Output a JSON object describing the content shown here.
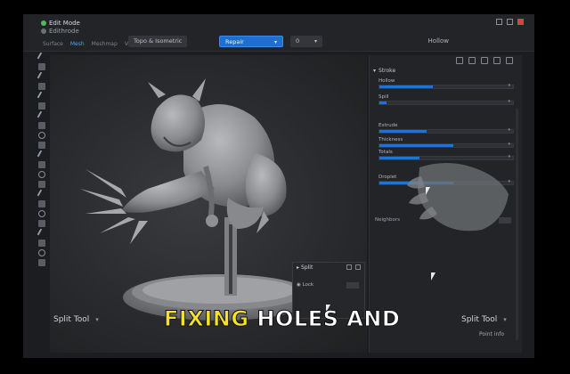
{
  "topbar": {
    "mode_title": "Edit Mode",
    "object_name": "Edithrode",
    "subtabs": [
      "Surface",
      "Mesh",
      "Meshmap",
      "Vopaint"
    ],
    "active_subtab_index": 1,
    "chip_mode": "Topo & Isometric",
    "chip_repair": "Repair",
    "chip_small": "0",
    "hollow_label": "Hollow"
  },
  "panel": {
    "section_title": "Stroke",
    "props": [
      {
        "label": "Hollow",
        "fill": 0.4
      },
      {
        "label": "Spill",
        "fill": 0.05
      },
      {
        "label": "Extrude",
        "fill": 0.35
      },
      {
        "label": "Thickness",
        "fill": 0.55
      },
      {
        "label": "Totals",
        "fill": 0.3
      },
      {
        "label": "Droplet",
        "fill": 0.55
      }
    ],
    "neighbors_label": "Neighbors",
    "mode_label": "Split Tool",
    "point_info": "Point info"
  },
  "viewport": {
    "mode_label": "Split Tool"
  },
  "popup": {
    "title": "Split",
    "row_label": "Lock"
  },
  "caption": {
    "highlight": "FIXING",
    "rest": "HOLES AND"
  },
  "colors": {
    "accent_blue": "#2273cf",
    "caption_yellow": "#f4e12a",
    "status_green": "#4dbb5f"
  }
}
